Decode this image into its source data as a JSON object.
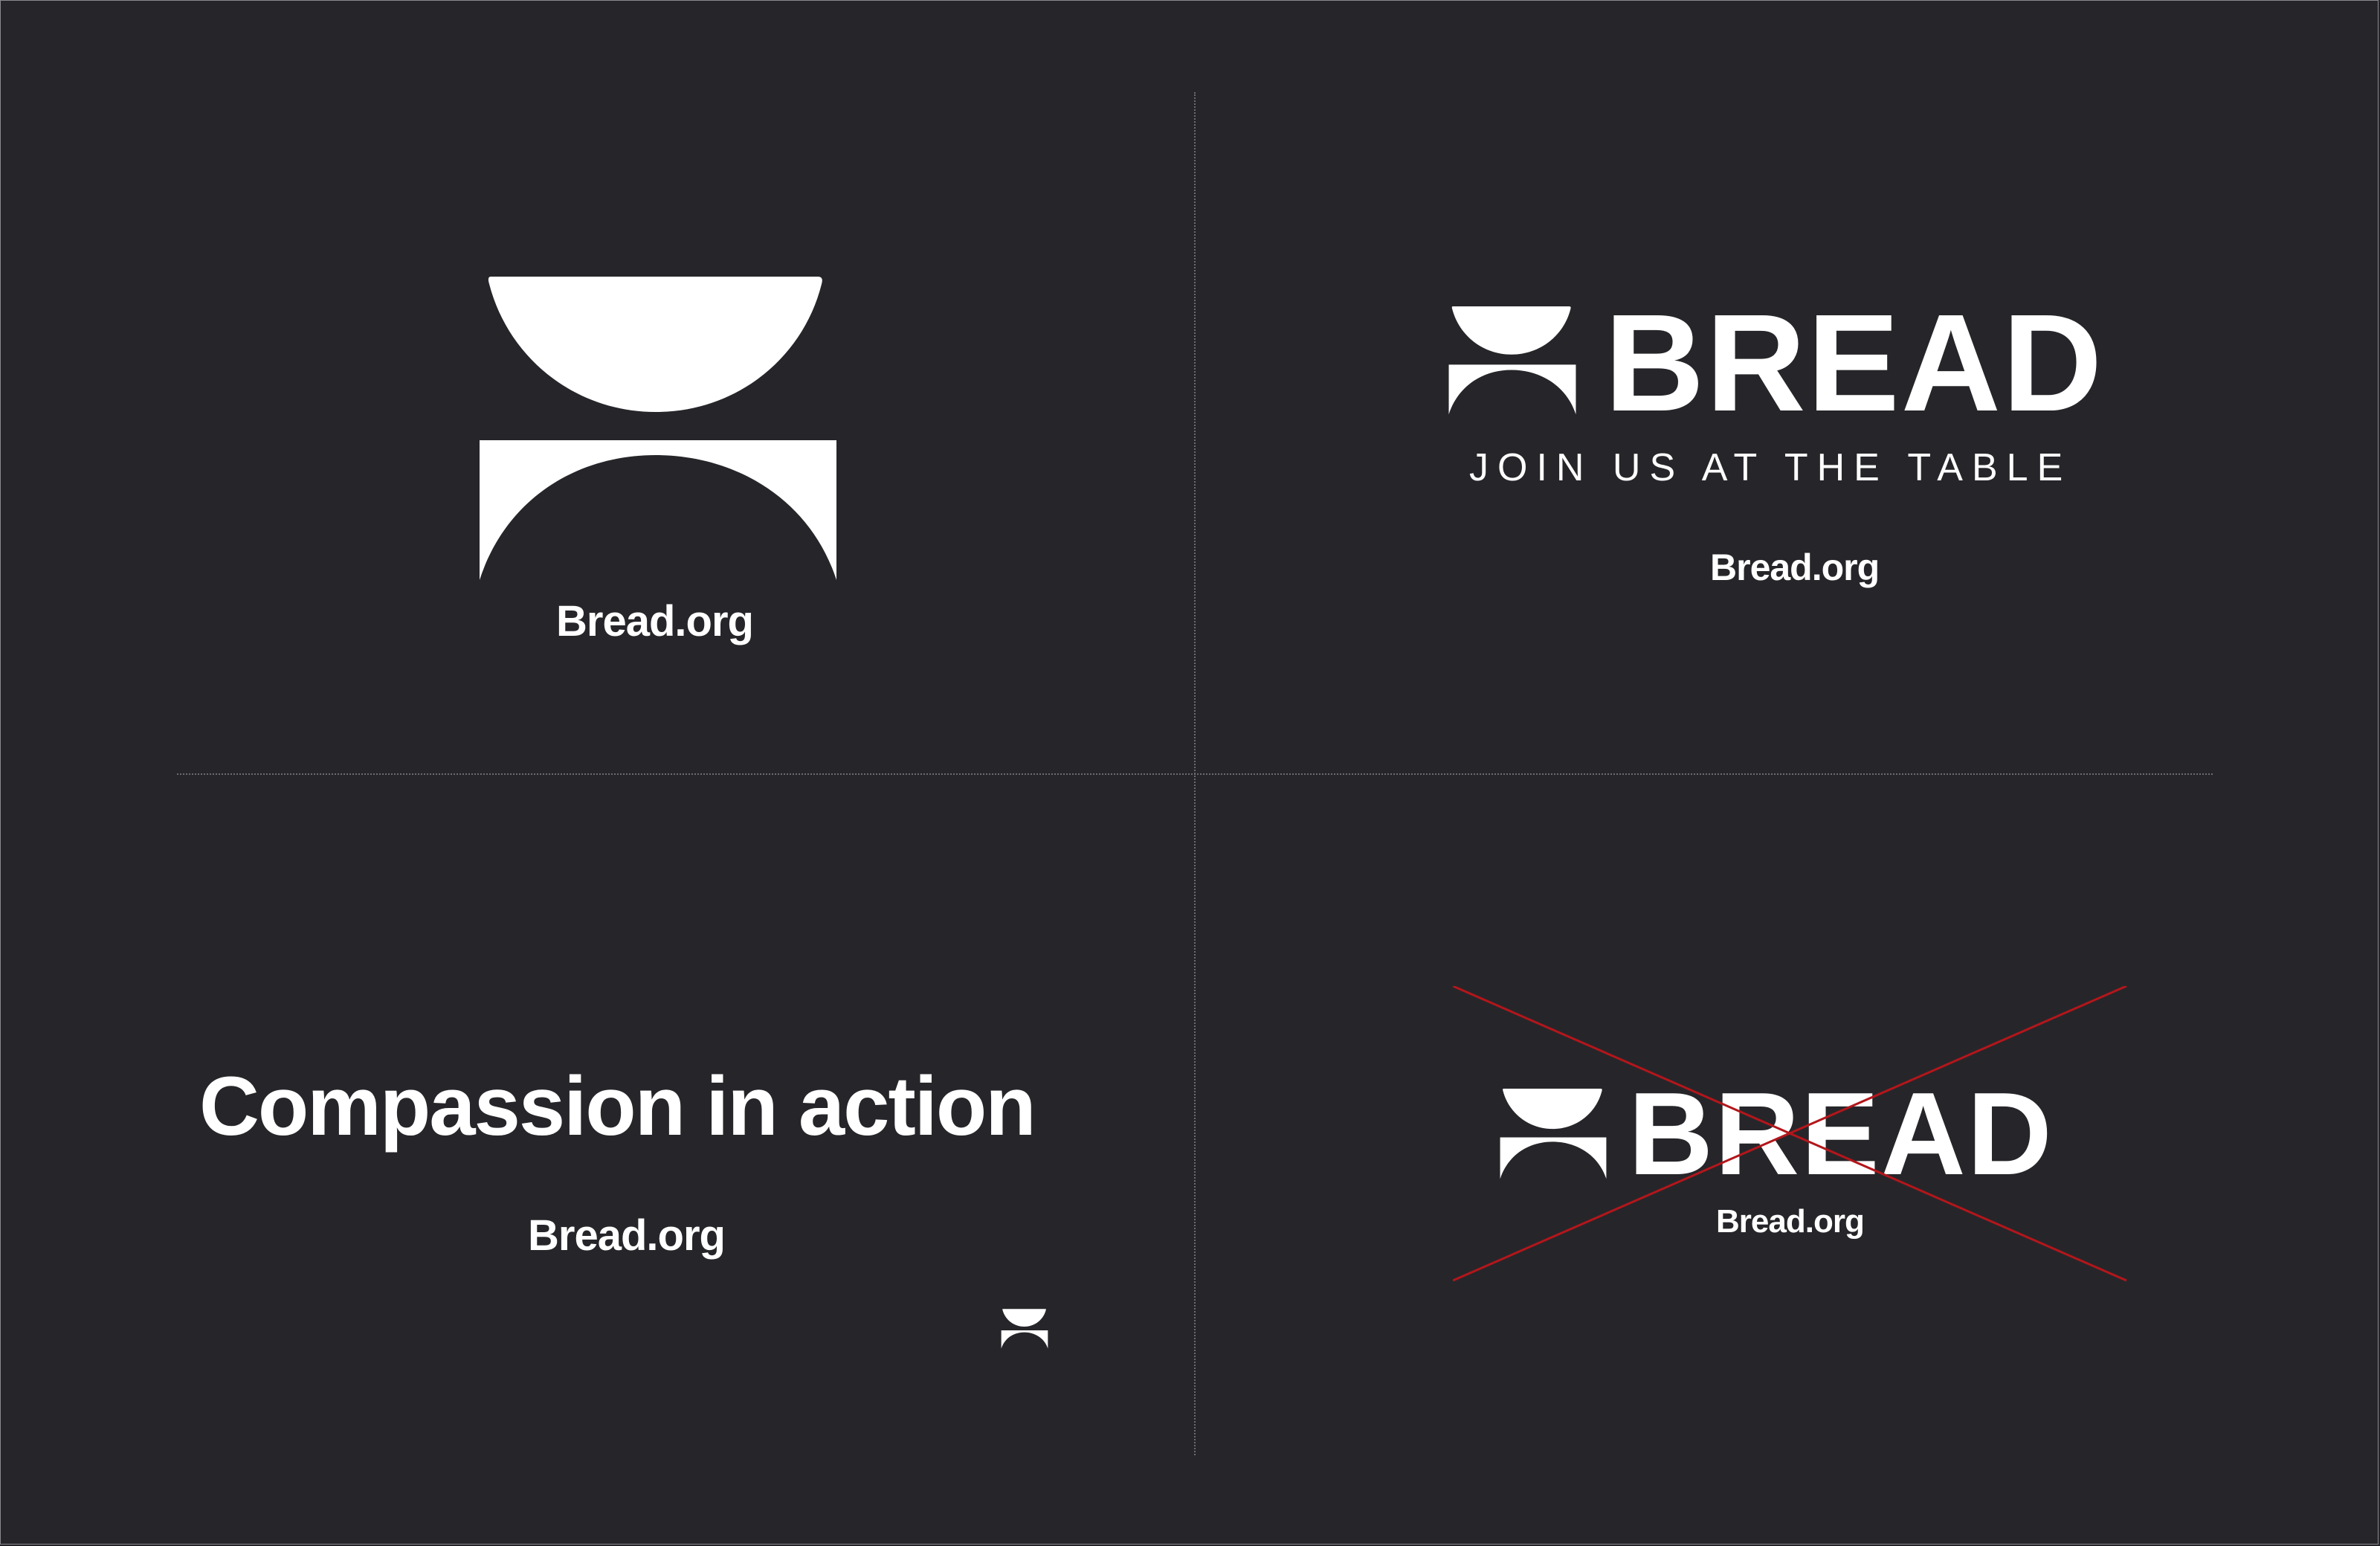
{
  "colors": {
    "background": "#26262a",
    "foreground": "#ffffff",
    "divider": "#6c6c70",
    "cross_out": "#b3161b"
  },
  "q1": {
    "icon": "bread-logo-icon",
    "url": "Bread.org"
  },
  "q2": {
    "icon": "bread-logo-icon",
    "wordmark": "BREAD",
    "tagline": "JOIN US AT THE TABLE",
    "url": "Bread.org"
  },
  "q3": {
    "headline": "Compassion in action",
    "url": "Bread.org",
    "icon": "bread-logo-icon"
  },
  "q4": {
    "icon": "bread-logo-icon",
    "wordmark": "BREAD",
    "url": "Bread.org",
    "overlay_icon": "cross-out-icon"
  }
}
